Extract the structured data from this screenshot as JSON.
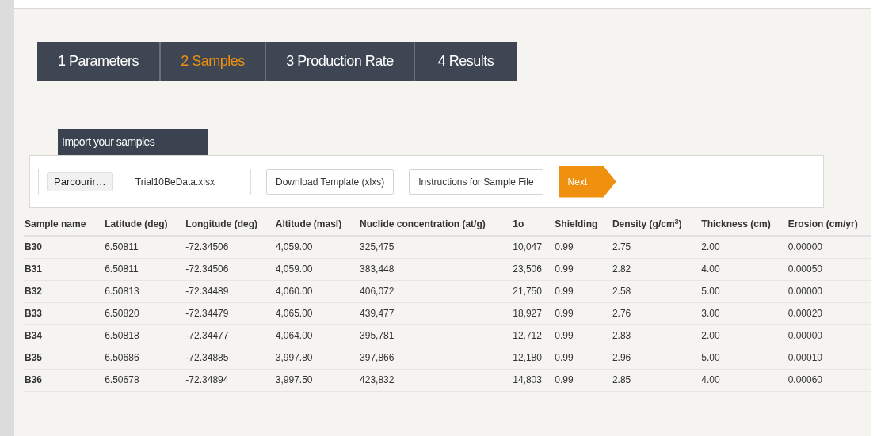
{
  "tabs": [
    {
      "label": "1 Parameters",
      "selected": false
    },
    {
      "label": "2 Samples",
      "selected": true
    },
    {
      "label": "3 Production Rate",
      "selected": false
    },
    {
      "label": "4 Results",
      "selected": false
    }
  ],
  "import_panel": {
    "title": "Import your samples",
    "browse_button": "Parcourir…",
    "file_name": "Trial10BeData.xlsx",
    "buttons": [
      "Download Template (xlxs)",
      "Instructions for Sample File"
    ],
    "next_button": "Next"
  },
  "table": {
    "columns": [
      "Sample name",
      "Latitude (deg)",
      "Longitude (deg)",
      "Altitude (masl)",
      "Nuclide concentration (at/g)",
      "1σ",
      "Shielding",
      "Density (g/cm$^{3}$)",
      "Thickness (cm)",
      "Erosion (cm/yr)"
    ],
    "rows": [
      [
        "B30",
        "6.50811",
        "-72.34506",
        "4,059.00",
        "325,475",
        "10,047",
        "0.99",
        "2.75",
        "2.00",
        "0.00000"
      ],
      [
        "B31",
        "6.50811",
        "-72.34506",
        "4,059.00",
        "383,448",
        "23,506",
        "0.99",
        "2.82",
        "4.00",
        "0.00050"
      ],
      [
        "B32",
        "6.50813",
        "-72.34489",
        "4,060.00",
        "406,072",
        "21,750",
        "0.99",
        "2.58",
        "5.00",
        "0.00000"
      ],
      [
        "B33",
        "6.50820",
        "-72.34479",
        "4,065.00",
        "439,477",
        "18,927",
        "0.99",
        "2.76",
        "3.00",
        "0.00020"
      ],
      [
        "B34",
        "6.50818",
        "-72.34477",
        "4,064.00",
        "395,781",
        "12,712",
        "0.99",
        "2.83",
        "2.00",
        "0.00000"
      ],
      [
        "B35",
        "6.50686",
        "-72.34885",
        "3,997.80",
        "397,866",
        "12,180",
        "0.99",
        "2.96",
        "5.00",
        "0.00010"
      ],
      [
        "B36",
        "6.50678",
        "-72.34894",
        "3,997.50",
        "423,832",
        "14,803",
        "0.99",
        "2.85",
        "4.00",
        "0.00060"
      ]
    ]
  }
}
